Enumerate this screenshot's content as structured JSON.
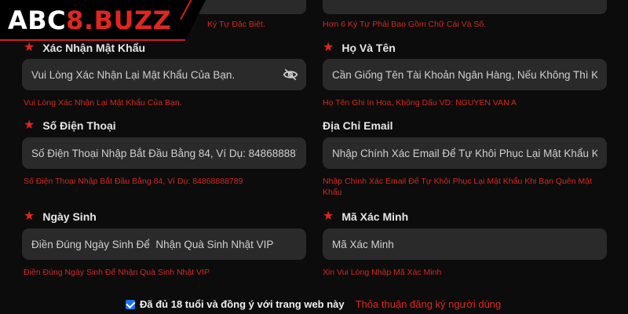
{
  "brand": {
    "part1": "ABC",
    "part2": "8.BUZZ"
  },
  "top_hints": {
    "left": "Ký Tự Đặc Biệt.",
    "right": "Hơn 6 Ký Tự Phải Bao Gồm Chữ Cái Và Số."
  },
  "fields": {
    "confirm_password": {
      "label": "Xác Nhận Mật Khẩu",
      "placeholder": "Vui Lòng Xác Nhận Lại Mật Khẩu Của Bạn.",
      "hint": "Vui Lòng Xác Nhận Lại Mật Khẩu Của Bạn."
    },
    "full_name": {
      "label": "Họ Và Tên",
      "placeholder": "Cần Giống Tên Tài Khoản Ngân Hàng, Nếu Không Thì Khôn",
      "hint": "Họ Tên Ghi In Hoa, Không Dấu VD: NGUYEN VAN A"
    },
    "phone": {
      "label": "Số Điện Thoại",
      "placeholder": "Số Điện Thoại Nhập Bắt Đầu Bằng 84, Ví Dụ: 84868888789",
      "hint": "Số Điện Thoại Nhập Bắt Đầu Bằng 84, Ví Dụ: 84868888789"
    },
    "email": {
      "label": "Địa Chỉ Email",
      "placeholder": "Nhập Chính Xác Email Để Tự Khôi Phục Lại Mật Khẩu Khi B",
      "hint": "Nhập Chính Xác Email Để Tự Khôi Phục Lại Mật Khẩu Khi Bạn Quên Mật Khẩu"
    },
    "birthday": {
      "label": "Ngày Sinh",
      "placeholder": "Điền Đúng Ngày Sinh Để  Nhận Quà Sinh Nhật VIP",
      "hint": "Điền Đúng Ngày Sinh Để Nhận Quà Sinh Nhật VIP"
    },
    "verification_code": {
      "label": "Mã Xác Minh",
      "placeholder": "Mã Xác Minh",
      "hint": "Xin Vui Lòng Nhập Mã Xác Minh"
    }
  },
  "agreement": {
    "checked": true,
    "text": "Đã đủ 18 tuổi và đồng ý với trang web này",
    "link": "Thỏa thuận đăng ký người dùng"
  },
  "colors": {
    "accent": "#e0261e",
    "background": "#0c0c0c",
    "input": "#2a2a2a",
    "checkbox": "#1a73e8"
  },
  "icons": {
    "star": "required-star-icon",
    "eye": "eye-off-icon",
    "search": "search-icon"
  }
}
